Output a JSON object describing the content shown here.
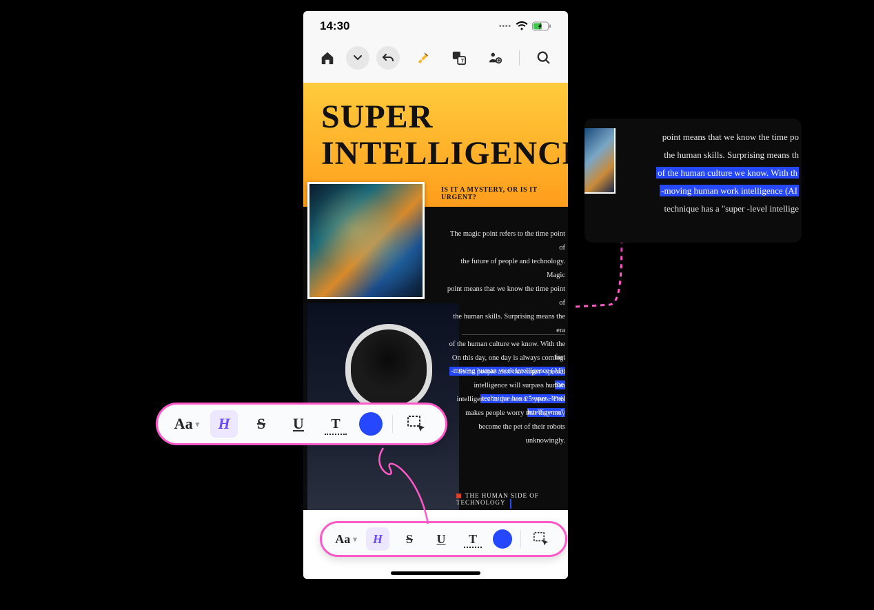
{
  "status": {
    "time": "14:30"
  },
  "doc": {
    "title_l1": "SUPER",
    "title_l2": "INTELLIGENCE",
    "subtitle": "IS IT A MYSTERY, OR IS IT URGENT?",
    "p1_a": "The magic point refers to the time point of",
    "p1_b": "the future of people and technology. Magic",
    "p1_c": "point means that we know the time point of",
    "p1_d": "the human skills. Surprising means the era",
    "p1_e": "of the human culture we know. With the fast",
    "p1_f": "-moving human work intelligence (AI), the",
    "p1_g": "technique has a \"super -level intelligence\"",
    "p2_a": "On this day, one day is always coming.",
    "p2_b": "Some people alert that super -special",
    "p2_c": "intelligence will surpass human",
    "p2_d": "intelligence in the next 25 years. This",
    "p2_e": "makes people worry that they may",
    "p2_f": "become the pet of their robots",
    "p2_g": "unknowingly.",
    "caption": "THE HUMAN SIDE OF TECHNOLOGY"
  },
  "fmt": {
    "aa": "Aa",
    "h": "H",
    "s": "S",
    "u": "U",
    "t": "T"
  },
  "callout": {
    "l1": "point means that we know the time po",
    "l2": "the human skills. Surprising means th",
    "l3": "of the human culture we know. With th",
    "l4": "-moving human work intelligence (AI",
    "l5": "technique has a \"super -level intellige"
  },
  "colors": {
    "highlight": "#2548ff",
    "accent": "#ff58c8"
  }
}
